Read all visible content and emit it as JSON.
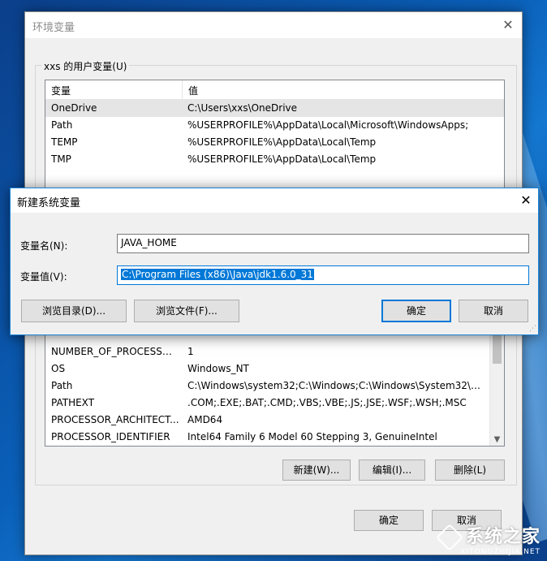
{
  "main_window": {
    "title": "环境变量",
    "close_glyph": "✕",
    "user_group_label": "xxs 的用户变量(U)",
    "columns": [
      "变量",
      "值"
    ],
    "user_vars": [
      {
        "name": "OneDrive",
        "value": "C:\\Users\\xxs\\OneDrive"
      },
      {
        "name": "Path",
        "value": "%USERPROFILE%\\AppData\\Local\\Microsoft\\WindowsApps;"
      },
      {
        "name": "TEMP",
        "value": "%USERPROFILE%\\AppData\\Local\\Temp"
      },
      {
        "name": "TMP",
        "value": "%USERPROFILE%\\AppData\\Local\\Temp"
      }
    ],
    "system_vars": [
      {
        "name": "NUMBER_OF_PROCESSORS",
        "value": "1"
      },
      {
        "name": "OS",
        "value": "Windows_NT"
      },
      {
        "name": "Path",
        "value": "C:\\Windows\\system32;C:\\Windows;C:\\Windows\\System32\\Wb..."
      },
      {
        "name": "PATHEXT",
        "value": ".COM;.EXE;.BAT;.CMD;.VBS;.VBE;.JS;.JSE;.WSF;.WSH;.MSC"
      },
      {
        "name": "PROCESSOR_ARCHITECT...",
        "value": "AMD64"
      },
      {
        "name": "PROCESSOR_IDENTIFIER",
        "value": "Intel64 Family 6 Model 60 Stepping 3, GenuineIntel"
      }
    ],
    "buttons": {
      "new": "新建(W)...",
      "edit": "编辑(I)...",
      "delete": "删除(L)",
      "ok": "确定",
      "cancel": "取消"
    }
  },
  "dialog": {
    "title": "新建系统变量",
    "close_glyph": "✕",
    "name_label": "变量名(N):",
    "name_value": "JAVA_HOME",
    "value_label": "变量值(V):",
    "value_value": "C:\\Program Files (x86)\\Java\\jdk1.6.0_31",
    "buttons": {
      "browse_dir": "浏览目录(D)...",
      "browse_file": "浏览文件(F)...",
      "ok": "确定",
      "cancel": "取消"
    }
  },
  "watermark": {
    "cn": "系统之家",
    "en": "XITONGZHIJIA.NET"
  },
  "colors": {
    "accent": "#0078d7",
    "desktop": "#0a5fb8"
  }
}
